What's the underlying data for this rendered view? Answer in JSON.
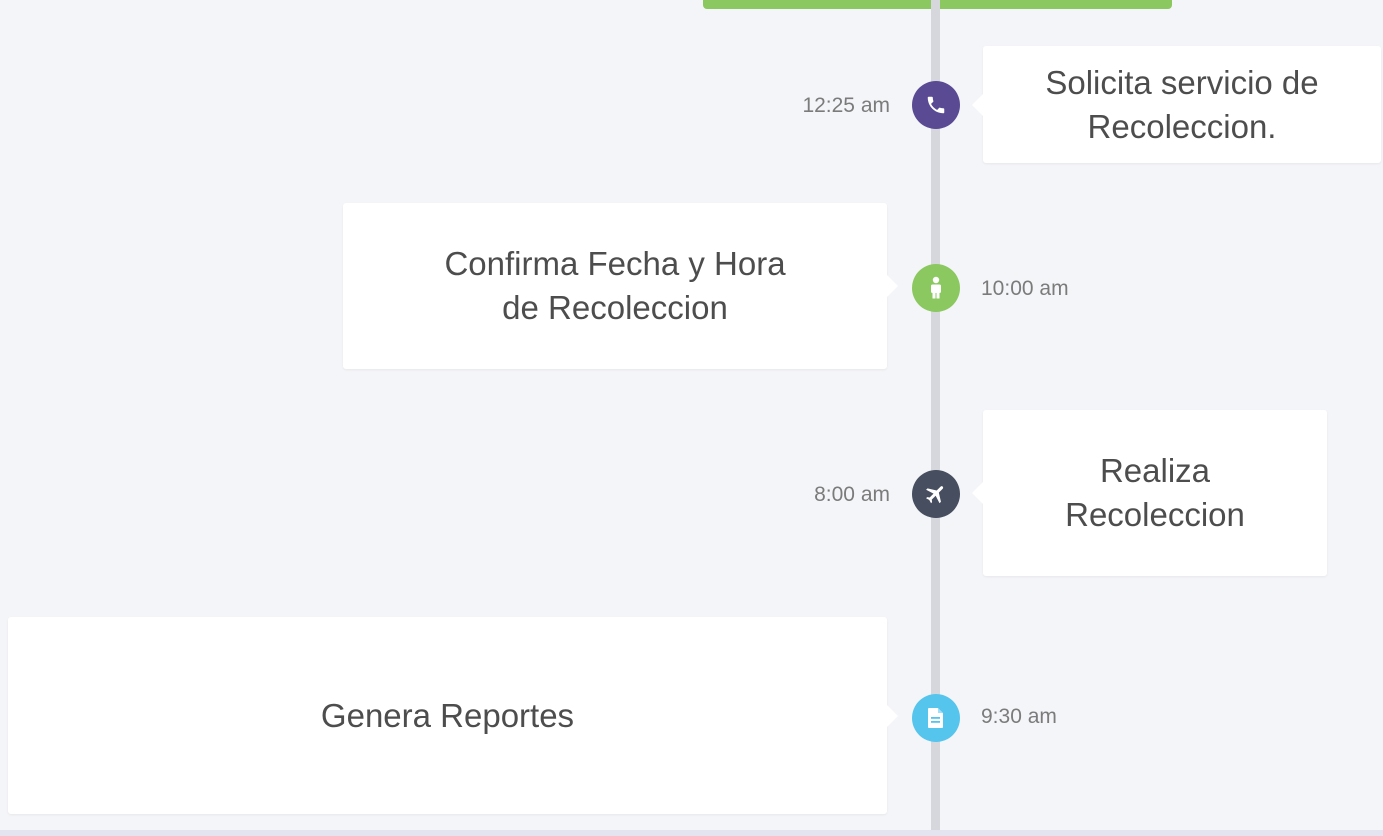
{
  "timeline": {
    "colors": {
      "phone": "#5a4a94",
      "person": "#8bc85f",
      "plane": "#474e60",
      "document": "#55c5ee",
      "top_bar": "#8bc85f",
      "line": "#d6d7dc"
    },
    "events": [
      {
        "time": "12:25 am",
        "text": "Solicita servicio de\nRecoleccion.",
        "icon": "phone-icon"
      },
      {
        "time": "10:00 am",
        "text": "Confirma Fecha y Hora\nde Recoleccion",
        "icon": "person-icon"
      },
      {
        "time": "8:00 am",
        "text": "Realiza\nRecoleccion",
        "icon": "plane-icon"
      },
      {
        "time": "9:30 am",
        "text": "Genera Reportes",
        "icon": "document-icon"
      }
    ]
  }
}
